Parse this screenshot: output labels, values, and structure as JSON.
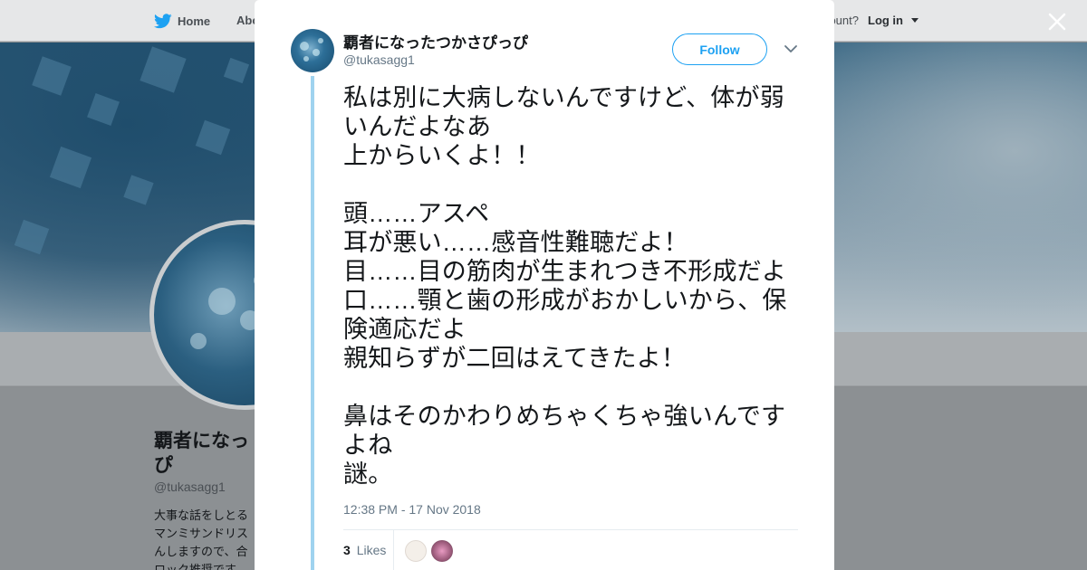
{
  "nav": {
    "home_label": "Home",
    "about_label": "Abo",
    "account_prompt": "ccount?",
    "login_label": "Log in"
  },
  "profile": {
    "name": "覇者になっ\nぴ",
    "handle": "@tukasagg1",
    "bio": "大事な話をしとる\nマンミサンドリス\nんしますので、合\nロック推奨です"
  },
  "tweet": {
    "display_name": "覇者になったつかさぴっぴ",
    "handle": "@tukasagg1",
    "follow_label": "Follow",
    "text": "私は別に大病しないんですけど、体が弱いんだよなあ\n上からいくよ！！\n\n頭……アスペ\n耳が悪い……感音性難聴だよ！\n目……目の筋肉が生まれつき不形成だよ\n口……顎と歯の形成がおかしいから、保険適応だよ\n親知らずが二回はえてきたよ！\n\n鼻はそのかわりめちゃくちゃ強いんですよね\n謎。",
    "timestamp": "12:38 PM - 17 Nov 2018",
    "likes_count": "3",
    "likes_label": "Likes"
  },
  "colors": {
    "accent": "#1da1f2",
    "thread_line": "#9fd3ef",
    "secondary_text": "#657786"
  },
  "icons": [
    "twitter-bird-icon",
    "home-icon",
    "close-icon",
    "chevron-down-icon"
  ]
}
